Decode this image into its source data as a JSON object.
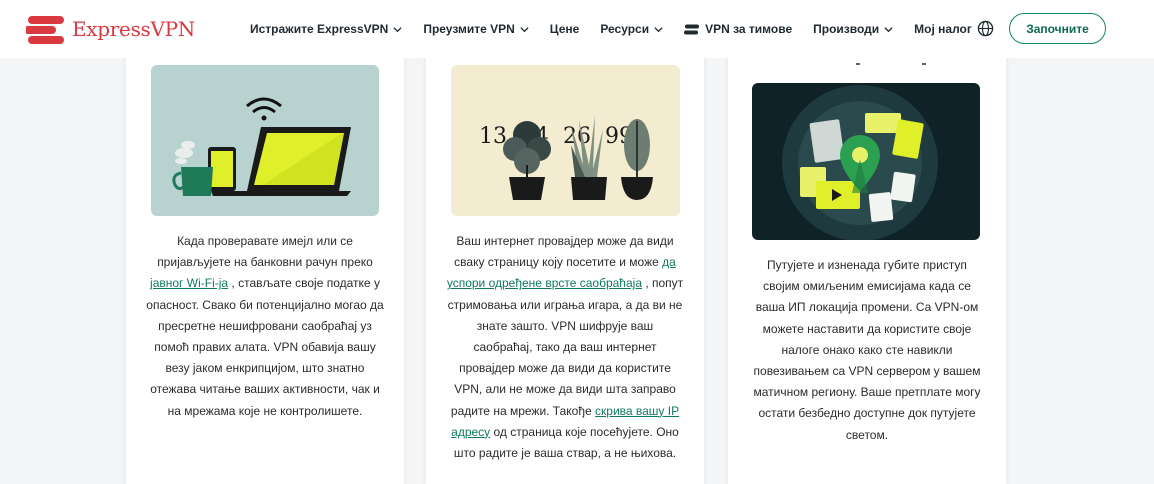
{
  "header": {
    "logo_text": "ExpressVPN",
    "nav": [
      {
        "label": "Истражите ExpressVPN",
        "has_chevron": true
      },
      {
        "label": "Преузмите VPN",
        "has_chevron": true
      },
      {
        "label": "Цене",
        "has_chevron": false
      },
      {
        "label": "Ресурси",
        "has_chevron": true
      },
      {
        "label": "VPN за тимове",
        "has_chevron": false,
        "icon": "team-icon"
      },
      {
        "label": "Производи",
        "has_chevron": true
      },
      {
        "label": "Мој налог",
        "has_chevron": false
      }
    ],
    "language_icon": "globe-icon",
    "cta_label": "Започните"
  },
  "colors": {
    "brand_red": "#da3940",
    "accent_green": "#0f8668",
    "link_green": "#0f7a61"
  },
  "cards": [
    {
      "illustration": "laptop-wifi-illustration",
      "text_before": "Када проверавате имејл или се пријављујете на банковни рачун преко ",
      "link": "јавног Wi-Fi-ја",
      "text_after": " , стављате своје податке у опасност. Свако би потенцијално могао да пресретне нешифровани саобраћај уз помоћ правих алата. VPN обавија вашу везу јаком енкрипцијом, што знатно отежава читање ваших активности, чак и на мрежама које не контролишете."
    },
    {
      "illustration": "plants-illustration",
      "illustration_numbers": "13  04  26  99",
      "text_before": "Ваш интернет провајдер може да види сваку страницу коју посетите и може ",
      "link": "да успори одређене врсте саобраћаја",
      "text_middle": " , попут стримовања или играња игара, а да ви не знате зашто. VPN шифрује ваш саобраћај, тако да ваш интернет провајдер може да види да користите VPN, али не може да види шта заправо радите на мрежи. Такође ",
      "link2": "скрива вашу IP адресу",
      "text_after": " од страница које посећујете. Оно што радите је ваша ствар, а не њихова."
    },
    {
      "illustration": "location-pin-illustration",
      "text": "Путујете и изненада губите приступ својим омиљеним емисијама када се ваша ИП локација промени. Са VPN-ом можете наставити да користите своје налоге онако како сте навикли повезивањем са VPN сервером у вашем матичном региону. Ваше претплате могу остати безбедно доступне док путујете светом."
    }
  ]
}
